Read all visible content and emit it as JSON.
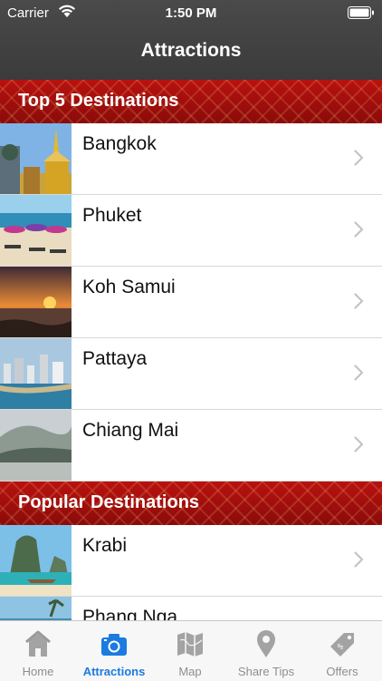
{
  "status": {
    "carrier": "Carrier",
    "time": "1:50 PM"
  },
  "header": {
    "title": "Attractions"
  },
  "sections": [
    {
      "title": "Top 5 Destinations",
      "items": [
        "Bangkok",
        "Phuket",
        "Koh Samui",
        "Pattaya",
        "Chiang Mai"
      ]
    },
    {
      "title": "Popular Destinations",
      "items": [
        "Krabi",
        "Phang Nga"
      ]
    }
  ],
  "tabs": [
    {
      "label": "Home",
      "icon": "home-icon"
    },
    {
      "label": "Attractions",
      "icon": "camera-icon",
      "active": true
    },
    {
      "label": "Map",
      "icon": "map-icon"
    },
    {
      "label": "Share Tips",
      "icon": "location-pin-icon"
    },
    {
      "label": "Offers",
      "icon": "price-tag-icon"
    }
  ],
  "colors": {
    "accent": "#1b7be0",
    "header_red": "#a50f0d",
    "bar_dark": "#434343"
  }
}
